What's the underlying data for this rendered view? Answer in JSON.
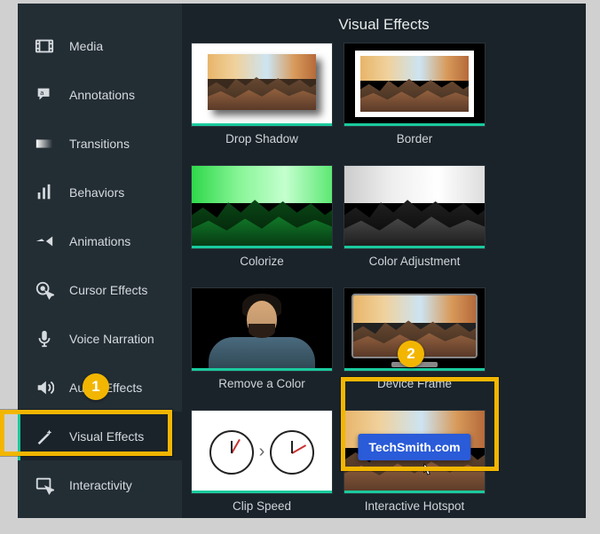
{
  "header": {
    "title": "Visual Effects"
  },
  "sidebar": {
    "items": [
      {
        "label": "Media"
      },
      {
        "label": "Annotations"
      },
      {
        "label": "Transitions"
      },
      {
        "label": "Behaviors"
      },
      {
        "label": "Animations"
      },
      {
        "label": "Cursor Effects"
      },
      {
        "label": "Voice Narration"
      },
      {
        "label": "Audio Effects"
      },
      {
        "label": "Visual Effects"
      },
      {
        "label": "Interactivity"
      }
    ],
    "active_index": 8
  },
  "effects": [
    {
      "label": "Drop Shadow"
    },
    {
      "label": "Border"
    },
    {
      "label": "Colorize"
    },
    {
      "label": "Color Adjustment"
    },
    {
      "label": "Remove a Color"
    },
    {
      "label": "Device Frame"
    },
    {
      "label": "Clip Speed"
    },
    {
      "label": "Interactive Hotspot"
    }
  ],
  "hotspot": {
    "badge_text": "TechSmith.com"
  },
  "callouts": {
    "num1": "1",
    "num2": "2"
  }
}
